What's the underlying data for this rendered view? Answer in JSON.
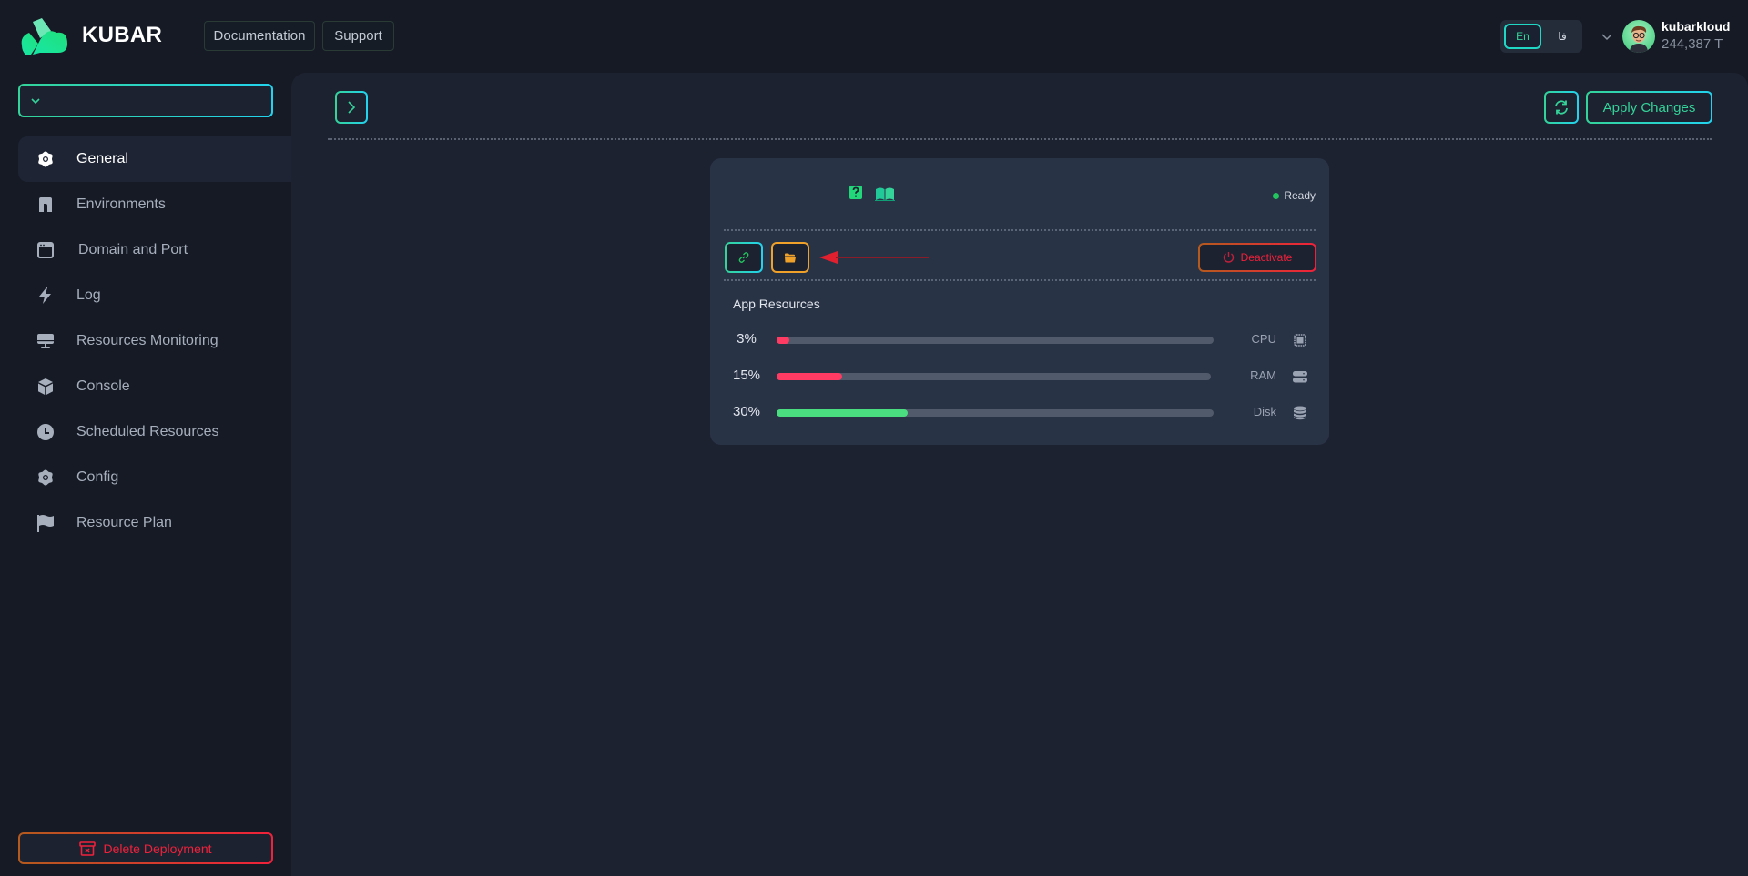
{
  "header": {
    "brand": "KUBAR",
    "documentation_label": "Documentation",
    "support_label": "Support",
    "language": {
      "options": [
        "En",
        "فا"
      ],
      "selected": "En"
    },
    "user": {
      "name": "kubarkloud",
      "balance": "244,387 T"
    }
  },
  "sidebar": {
    "select": {
      "value": ""
    },
    "items": [
      {
        "label": "General",
        "icon": "gear-icon",
        "active": true
      },
      {
        "label": "Environments",
        "icon": "environment-icon",
        "active": false
      },
      {
        "label": "Domain and Port",
        "icon": "browser-window-icon",
        "active": false
      },
      {
        "label": "Log",
        "icon": "bolt-icon",
        "active": false
      },
      {
        "label": "Resources Monitoring",
        "icon": "monitor-icon",
        "active": false
      },
      {
        "label": "Console",
        "icon": "cube-icon",
        "active": false
      },
      {
        "label": "Scheduled Resources",
        "icon": "clock-icon",
        "active": false
      },
      {
        "label": "Config",
        "icon": "gear-icon",
        "active": false
      },
      {
        "label": "Resource Plan",
        "icon": "flag-icon",
        "active": false
      }
    ],
    "delete_label": "Delete Deployment"
  },
  "toolbar": {
    "apply_label": "Apply Changes"
  },
  "card": {
    "status": "Ready",
    "deactivate_label": "Deactivate",
    "resources_title": "App Resources",
    "resources": [
      {
        "label": "CPU",
        "percent_text": "3%",
        "value": 3,
        "color": "#ff3a63",
        "icon": "cpu-icon"
      },
      {
        "label": "RAM",
        "percent_text": "15%",
        "value": 15,
        "color": "#ff3a63",
        "icon": "server-icon"
      },
      {
        "label": "Disk",
        "percent_text": "30%",
        "value": 30,
        "color": "#4ade80",
        "icon": "database-icon"
      }
    ]
  },
  "colors": {
    "accent_green": "#34d399",
    "accent_cyan": "#22d3ee",
    "danger": "#f0213a",
    "warning": "#f0a12a",
    "status_ready": "#22c55e"
  }
}
